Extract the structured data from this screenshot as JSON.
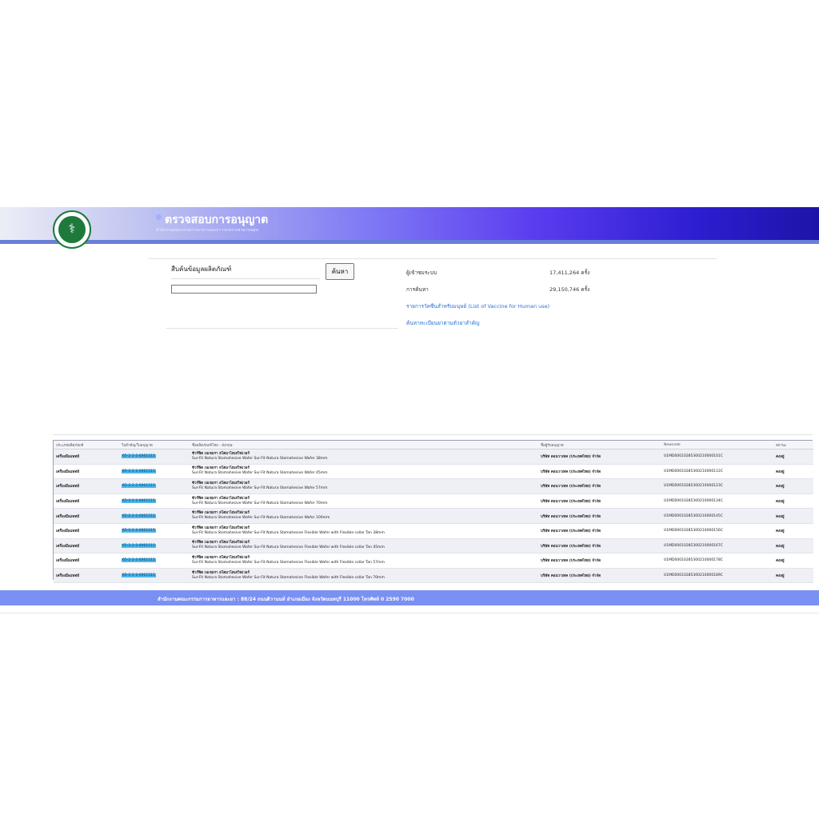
{
  "header": {
    "title": "ตรวจสอบการอนุญาต",
    "subtitle": "สำนักงานคณะกรรมการอาหารและยา กระทรวงสาธารณสุข",
    "logo_icon": "ministry-seal-icon",
    "gradient_colors": [
      "#eceef6",
      "#5b3df0",
      "#1e13a8"
    ]
  },
  "search": {
    "label": "สืบค้นข้อมูลผลิตภัณฑ์",
    "button_label": "ค้นหา",
    "input_value": "",
    "input_placeholder": ""
  },
  "stats": {
    "visitors_label": "ผู้เข้าชมระบบ",
    "visitors_value": "17,411,264 ครั้ง",
    "searches_label": "การค้นหา",
    "searches_value": "29,150,746 ครั้ง"
  },
  "links": {
    "vaccine": "รายการวัคซีนสำหรับมนุษย์ (List of Vaccine for Human use)",
    "registry": "ค้นหาทะเบียนยาตามตัวยาสำคัญ"
  },
  "table": {
    "headers": [
      "ประเภทผลิตภัณฑ์",
      "ใบสำคัญ/ใบอนุญาต",
      "ชื่อผลิตภัณฑ์ไทย - อังกฤษ",
      "ชื่อผู้รับอนุญาต",
      "Newcode",
      "สถานะ"
    ],
    "rows": [
      {
        "type": "เครื่องมือแพทย์",
        "license": "65-2-2-2-0001515",
        "name_th": "ซัวร์ฟิต เนเชอรา สโตมาไฮเสวิฟเวอร์",
        "name_en": "Sur-Fit Natura Stomahesive Wafer Sur-Fit Natura Stomahesive Wafer 38mm",
        "holder": "บริษัท คอนวาเทค (ประเทศไทย) จำกัด",
        "newcode": "U1MD00010285300210000101C",
        "status": "คงอยู่"
      },
      {
        "type": "เครื่องมือแพทย์",
        "license": "65-2-2-2-0001515",
        "name_th": "ซัวร์ฟิต เนเชอรา สโตมาไฮเสวิฟเวอร์",
        "name_en": "Sur-Fit Natura Stomahesive Wafer Sur-Fit Natura Stomahesive Wafer 45mm",
        "holder": "บริษัท คอนวาเทค (ประเทศไทย) จำกัด",
        "newcode": "U1MD00010285300210000112C",
        "status": "คงอยู่"
      },
      {
        "type": "เครื่องมือแพทย์",
        "license": "65-2-2-2-0001515",
        "name_th": "ซัวร์ฟิต เนเชอรา สโตมาไฮเสวิฟเวอร์",
        "name_en": "Sur-Fit Natura Stomahesive Wafer Sur-Fit Natura Stomahesive Wafer 57mm",
        "holder": "บริษัท คอนวาเทค (ประเทศไทย) จำกัด",
        "newcode": "U1MD00010285300210000123C",
        "status": "คงอยู่"
      },
      {
        "type": "เครื่องมือแพทย์",
        "license": "65-2-2-2-0001515",
        "name_th": "ซัวร์ฟิต เนเชอรา สโตมาไฮเสวิฟเวอร์",
        "name_en": "Sur-Fit Natura Stomahesive Wafer Sur-Fit Natura Stomahesive Wafer 70mm",
        "holder": "บริษัท คอนวาเทค (ประเทศไทย) จำกัด",
        "newcode": "U1MD00010285300210000134C",
        "status": "คงอยู่"
      },
      {
        "type": "เครื่องมือแพทย์",
        "license": "65-2-2-2-0001515",
        "name_th": "ซัวร์ฟิต เนเชอรา สโตมาไฮเสวิฟเวอร์",
        "name_en": "Sur-Fit Natura Stomahesive Wafer Sur-Fit Natura Stomahesive Wafer 100mm",
        "holder": "บริษัท คอนวาเทค (ประเทศไทย) จำกัด",
        "newcode": "U1MD00010285300210000145C",
        "status": "คงอยู่"
      },
      {
        "type": "เครื่องมือแพทย์",
        "license": "65-2-2-2-0001515",
        "name_th": "ซัวร์ฟิต เนเชอรา สโตมาไฮเสวิฟเวอร์",
        "name_en": "Sur-Fit Natura Stomahesive Wafer Sur-Fit Natura Stomahesive Flexible Wafer with Flexible collar Tan 38mm",
        "holder": "บริษัท คอนวาเทค (ประเทศไทย) จำกัด",
        "newcode": "U1MD00010285300210000156C",
        "status": "คงอยู่"
      },
      {
        "type": "เครื่องมือแพทย์",
        "license": "65-2-2-2-0001515",
        "name_th": "ซัวร์ฟิต เนเชอรา สโตมาไฮเสวิฟเวอร์",
        "name_en": "Sur-Fit Natura Stomahesive Wafer Sur-Fit Natura Stomahesive Flexible Wafer with Flexible collar Tan 45mm",
        "holder": "บริษัท คอนวาเทค (ประเทศไทย) จำกัด",
        "newcode": "U1MD00010285300210000167C",
        "status": "คงอยู่"
      },
      {
        "type": "เครื่องมือแพทย์",
        "license": "65-2-2-2-0001515",
        "name_th": "ซัวร์ฟิต เนเชอรา สโตมาไฮเสวิฟเวอร์",
        "name_en": "Sur-Fit Natura Stomahesive Wafer Sur-Fit Natura Stomahesive Flexible Wafer with Flexible collar Tan 57mm",
        "holder": "บริษัท คอนวาเทค (ประเทศไทย) จำกัด",
        "newcode": "U1MD00010285300210000178C",
        "status": "คงอยู่"
      },
      {
        "type": "เครื่องมือแพทย์",
        "license": "65-2-2-2-0001515",
        "name_th": "ซัวร์ฟิต เนเชอรา สโตมาไฮเสวิฟเวอร์",
        "name_en": "Sur-Fit Natura Stomahesive Wafer Sur-Fit Natura Stomahesive Flexible Wafer with Flexible collar Tan 70mm",
        "holder": "บริษัท คอนวาเทค (ประเทศไทย) จำกัด",
        "newcode": "U1MD00010285300210000189C",
        "status": "คงอยู่"
      }
    ]
  },
  "footer": {
    "text": "สำนักงานคณะกรรมการอาหารและยา : 88/24 ถนนติวานนท์ อำเภอเมือง จังหวัดนนทบุรี 11000 โทรศัพท์ 0 2590 7000"
  }
}
